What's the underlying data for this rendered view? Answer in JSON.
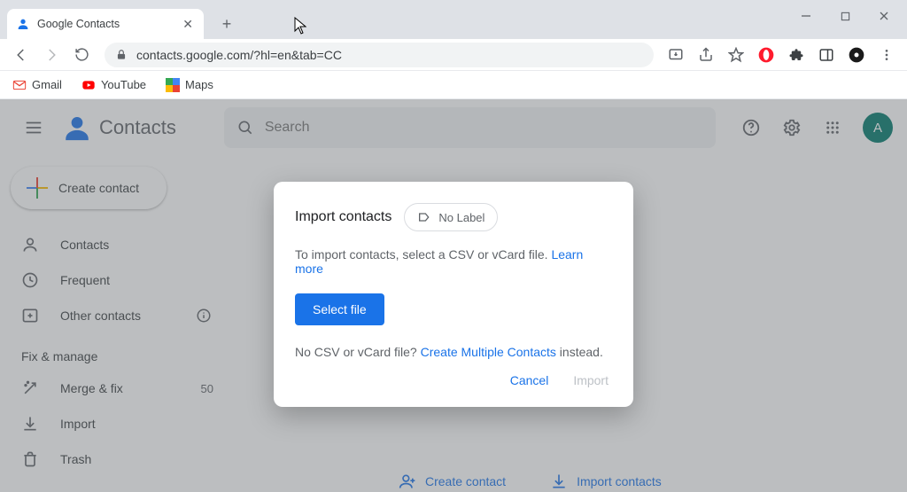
{
  "browser": {
    "tab_title": "Google Contacts",
    "url": "contacts.google.com/?hl=en&tab=CC",
    "bookmarks": [
      {
        "label": "Gmail"
      },
      {
        "label": "YouTube"
      },
      {
        "label": "Maps"
      }
    ]
  },
  "header": {
    "app_title": "Contacts",
    "search_placeholder": "Search",
    "avatar_letter": "A"
  },
  "sidebar": {
    "create_label": "Create contact",
    "items_primary": [
      {
        "label": "Contacts"
      },
      {
        "label": "Frequent"
      },
      {
        "label": "Other contacts"
      }
    ],
    "section_label": "Fix & manage",
    "items_manage": [
      {
        "label": "Merge & fix",
        "count": "50"
      },
      {
        "label": "Import"
      },
      {
        "label": "Trash"
      }
    ]
  },
  "main": {
    "create_contact": "Create contact",
    "import_contacts": "Import contacts"
  },
  "dialog": {
    "title": "Import contacts",
    "label_chip": "No Label",
    "line1_pre": "To import contacts, select a CSV or vCard file. ",
    "learn_more": "Learn more",
    "select_file": "Select file",
    "line2_pre": "No CSV or vCard file? ",
    "create_multiple": "Create Multiple Contacts",
    "line2_post": " instead.",
    "cancel": "Cancel",
    "import": "Import"
  }
}
